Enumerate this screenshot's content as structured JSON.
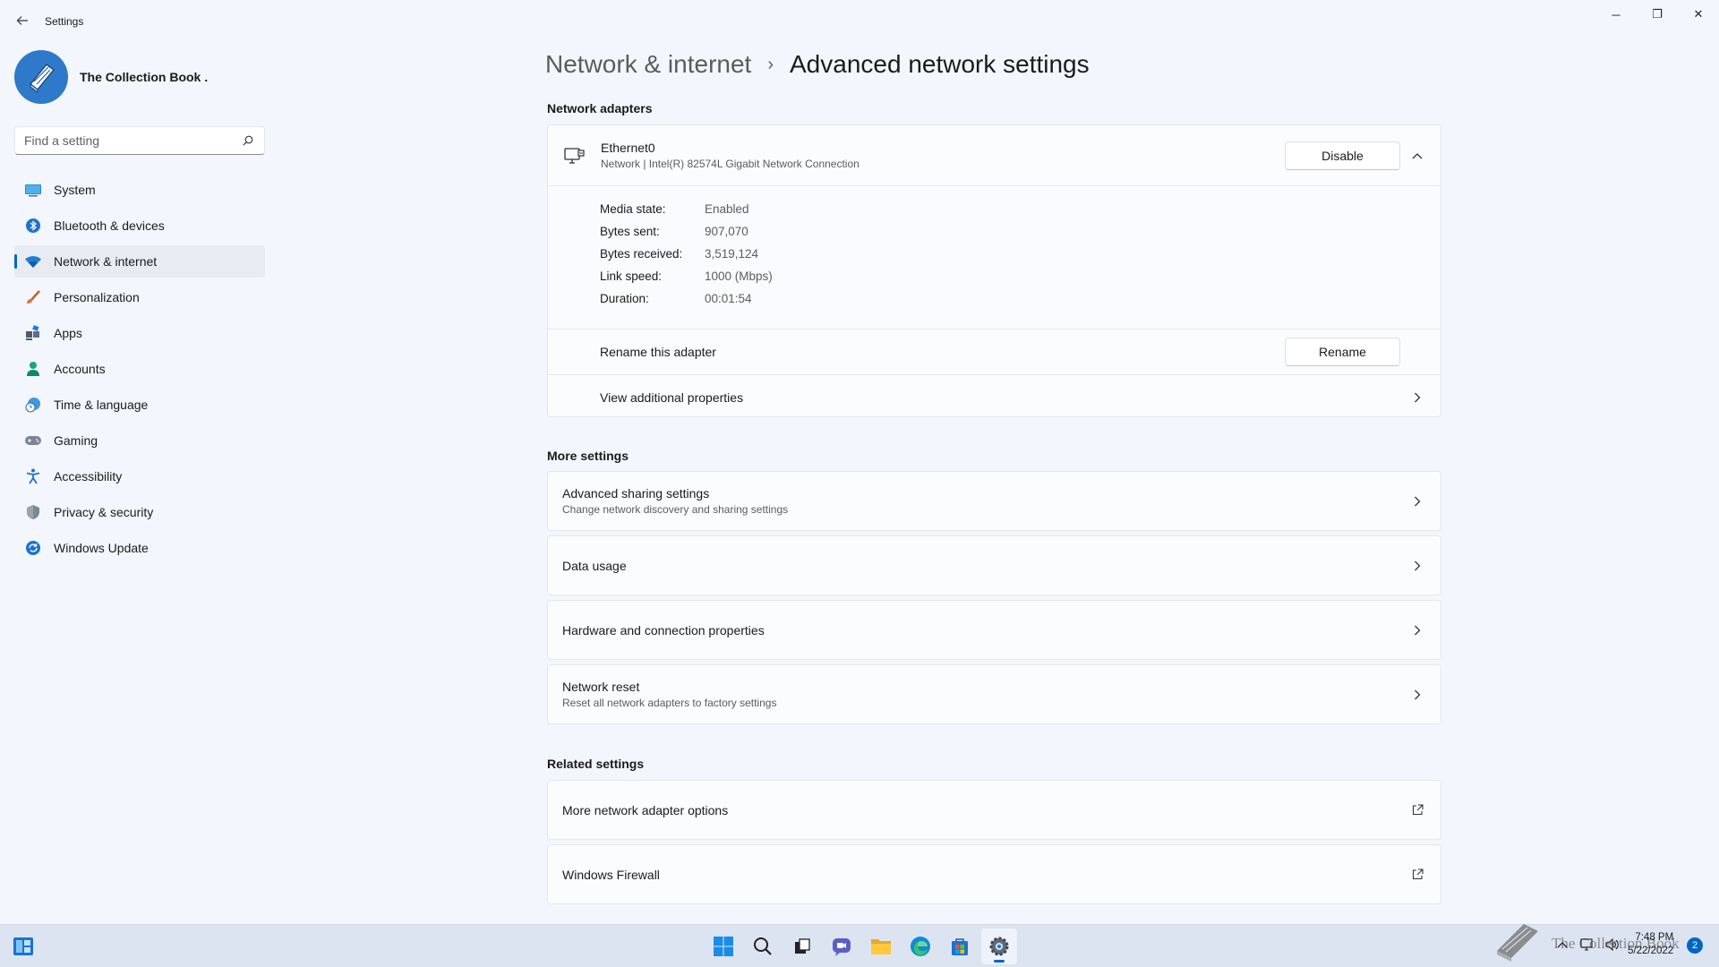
{
  "window": {
    "title": "Settings",
    "controls": {
      "minimize": "─",
      "restore": "❐",
      "close": "✕"
    }
  },
  "profile": {
    "name": "The Collection Book ."
  },
  "search": {
    "placeholder": "Find a setting"
  },
  "sidebar": {
    "items": [
      {
        "label": "System",
        "icon": "system-icon"
      },
      {
        "label": "Bluetooth & devices",
        "icon": "bluetooth-icon"
      },
      {
        "label": "Network & internet",
        "icon": "wifi-icon",
        "active": true
      },
      {
        "label": "Personalization",
        "icon": "brush-icon"
      },
      {
        "label": "Apps",
        "icon": "apps-icon"
      },
      {
        "label": "Accounts",
        "icon": "person-icon"
      },
      {
        "label": "Time & language",
        "icon": "globe-clock-icon"
      },
      {
        "label": "Gaming",
        "icon": "gamepad-icon"
      },
      {
        "label": "Accessibility",
        "icon": "accessibility-icon"
      },
      {
        "label": "Privacy & security",
        "icon": "shield-icon"
      },
      {
        "label": "Windows Update",
        "icon": "update-icon"
      }
    ]
  },
  "breadcrumb": {
    "parent": "Network & internet",
    "separator": "›",
    "current": "Advanced network settings"
  },
  "adapters": {
    "section_title": "Network adapters",
    "adapter": {
      "name": "Ethernet0",
      "description": "Network | Intel(R) 82574L Gigabit Network Connection",
      "disable_label": "Disable",
      "properties": [
        {
          "label": "Media state:",
          "value": "Enabled"
        },
        {
          "label": "Bytes sent:",
          "value": "907,070"
        },
        {
          "label": "Bytes received:",
          "value": "3,519,124"
        },
        {
          "label": "Link speed:",
          "value": "1000 (Mbps)"
        },
        {
          "label": "Duration:",
          "value": "00:01:54"
        }
      ],
      "rename_text": "Rename this adapter",
      "rename_label": "Rename",
      "view_props": "View additional properties"
    }
  },
  "more_settings": {
    "section_title": "More settings",
    "items": [
      {
        "title": "Advanced sharing settings",
        "subtitle": "Change network discovery and sharing settings"
      },
      {
        "title": "Data usage",
        "subtitle": ""
      },
      {
        "title": "Hardware and connection properties",
        "subtitle": ""
      },
      {
        "title": "Network reset",
        "subtitle": "Reset all network adapters to factory settings"
      }
    ]
  },
  "related_settings": {
    "section_title": "Related settings",
    "items": [
      {
        "title": "More network adapter options"
      },
      {
        "title": "Windows Firewall"
      }
    ]
  },
  "taskbar": {
    "apps": [
      "start-icon",
      "search-icon",
      "task-view-icon",
      "chat-icon",
      "file-explorer-icon",
      "edge-icon",
      "store-icon",
      "settings-icon"
    ],
    "watermark": "The Collection Book",
    "clock_time": "7:48 PM",
    "clock_date": "5/22/2022",
    "notification_count": "2"
  },
  "colors": {
    "accent": "#0067c0",
    "background": "#f3f6fc",
    "taskbar": "#dce4f1"
  }
}
